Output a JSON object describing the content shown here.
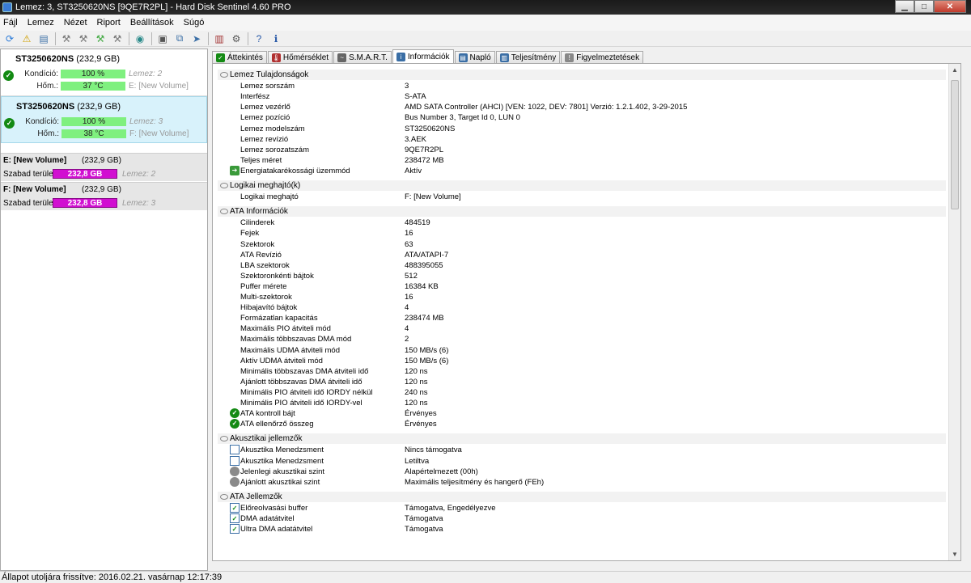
{
  "window": {
    "title": "Lemez: 3, ST3250620NS [9QE7R2PL]  -  Hard Disk Sentinel 4.60 PRO"
  },
  "menu": [
    "Fájl",
    "Lemez",
    "Nézet",
    "Riport",
    "Beállítások",
    "Súgó"
  ],
  "toolbar_icons": [
    "refresh-icon",
    "alert-icon",
    "report-icon",
    "tool1-icon",
    "tool2-icon",
    "tool3-icon",
    "tool4-icon",
    "globe-icon",
    "disk-test-icon",
    "copy-icon",
    "send-icon",
    "chart-icon",
    "settings-icon",
    "help-icon",
    "info-icon"
  ],
  "disks": [
    {
      "name": "ST3250620NS",
      "size": " (232,9 GB)",
      "condition_label": "Kondíció:",
      "condition": "100 %",
      "condition_disk": "Lemez: 2",
      "temp_label": "Hőm.:",
      "temp": "37 °C",
      "volume": "E: [New Volume]",
      "selected": false
    },
    {
      "name": "ST3250620NS",
      "size": " (232,9 GB)",
      "condition_label": "Kondíció:",
      "condition": "100 %",
      "condition_disk": "Lemez: 3",
      "temp_label": "Hőm.:",
      "temp": "38 °C",
      "volume": "F: [New Volume]",
      "selected": true
    }
  ],
  "volumes": [
    {
      "name": "E: [New Volume]",
      "size": "(232,9 GB)",
      "free_label": "Szabad terület",
      "free": "232,8 GB",
      "disk": "Lemez: 2"
    },
    {
      "name": "F: [New Volume]",
      "size": "(232,9 GB)",
      "free_label": "Szabad terület",
      "free": "232,8 GB",
      "disk": "Lemez: 3"
    }
  ],
  "tabs": [
    {
      "label": "Áttekintés",
      "active": false,
      "color": "#138a13"
    },
    {
      "label": "Hőmérséklet",
      "active": false,
      "color": "#b03030"
    },
    {
      "label": "S.M.A.R.T.",
      "active": false,
      "color": "#666666"
    },
    {
      "label": "Információk",
      "active": true,
      "color": "#3a6ea5"
    },
    {
      "label": "Napló",
      "active": false,
      "color": "#3a6ea5"
    },
    {
      "label": "Teljesítmény",
      "active": false,
      "color": "#3a6ea5"
    },
    {
      "label": "Figyelmeztetések",
      "active": false,
      "color": "#888888"
    }
  ],
  "sections": [
    {
      "title": "Lemez Tulajdonságok",
      "rows": [
        {
          "k": "Lemez sorszám",
          "v": "3"
        },
        {
          "k": "Interfész",
          "v": "S-ATA"
        },
        {
          "k": "Lemez vezérlő",
          "v": "AMD SATA Controller (AHCI) [VEN: 1022, DEV: 7801] Verzió: 1.2.1.402, 3-29-2015"
        },
        {
          "k": "Lemez pozíció",
          "v": "Bus Number 3, Target Id 0, LUN 0"
        },
        {
          "k": "Lemez modelszám",
          "v": "ST3250620NS"
        },
        {
          "k": "Lemez revízió",
          "v": "3.AEK"
        },
        {
          "k": "Lemez sorozatszám",
          "v": "9QE7R2PL"
        },
        {
          "k": "Teljes méret",
          "v": "238472 MB"
        },
        {
          "k": "Energiatakarékossági üzemmód",
          "v": "Aktív",
          "icon": "arrow"
        }
      ]
    },
    {
      "title": "Logikai meghajtó(k)",
      "rows": [
        {
          "k": "Logikai meghajtó",
          "v": "F: [New Volume]"
        }
      ]
    },
    {
      "title": "ATA Információk",
      "rows": [
        {
          "k": "Cilinderek",
          "v": "484519"
        },
        {
          "k": "Fejek",
          "v": "16"
        },
        {
          "k": "Szektorok",
          "v": "63"
        },
        {
          "k": "ATA Revízió",
          "v": "ATA/ATAPI-7"
        },
        {
          "k": "LBA szektorok",
          "v": "488395055"
        },
        {
          "k": "Szektoronkénti bájtok",
          "v": "512"
        },
        {
          "k": "Puffer mérete",
          "v": "16384 KB"
        },
        {
          "k": "Multi-szektorok",
          "v": "16"
        },
        {
          "k": "Hibajavító bájtok",
          "v": "4"
        },
        {
          "k": "Formázatlan kapacitás",
          "v": "238474 MB"
        },
        {
          "k": "Maximális PIO átviteli mód",
          "v": "4"
        },
        {
          "k": "Maximális többszavas DMA mód",
          "v": "2"
        },
        {
          "k": "Maximális UDMA átviteli mód",
          "v": "150 MB/s (6)"
        },
        {
          "k": "Aktív UDMA átviteli mód",
          "v": "150 MB/s (6)"
        },
        {
          "k": "Minimális többszavas DMA átviteli idő",
          "v": "120 ns"
        },
        {
          "k": "Ajánlott többszavas DMA átviteli idő",
          "v": "120 ns"
        },
        {
          "k": "Minimális PIO átviteli idő IORDY nélkül",
          "v": "240 ns"
        },
        {
          "k": "Minimális PIO átviteli idő IORDY-vel",
          "v": "120 ns"
        },
        {
          "k": "ATA kontroll bájt",
          "v": "Érvényes",
          "icon": "ok"
        },
        {
          "k": "ATA ellenőrző összeg",
          "v": "Érvényes",
          "icon": "ok"
        }
      ]
    },
    {
      "title": "Akusztikai jellemzők",
      "rows": [
        {
          "k": "Akusztika Menedzsment",
          "v": "Nincs támogatva",
          "icon": "box"
        },
        {
          "k": "Akusztika Menedzsment",
          "v": "Letiltva",
          "icon": "box"
        },
        {
          "k": "Jelenlegi akusztikai szint",
          "v": "Alapértelmezett (00h)",
          "icon": "spk"
        },
        {
          "k": "Ajánlott akusztikai szint",
          "v": "Maximális teljesítmény és hangerő (FEh)",
          "icon": "spk"
        }
      ]
    },
    {
      "title": "ATA Jellemzők",
      "rows": [
        {
          "k": "Előreolvasási buffer",
          "v": "Támogatva, Engedélyezve",
          "icon": "chk"
        },
        {
          "k": "DMA adatátvitel",
          "v": "Támogatva",
          "icon": "chk"
        },
        {
          "k": "Ultra DMA adatátvitel",
          "v": "Támogatva",
          "icon": "chk"
        }
      ]
    }
  ],
  "status": "Állapot utoljára frissítve: 2016.02.21. vasárnap 12:17:39"
}
